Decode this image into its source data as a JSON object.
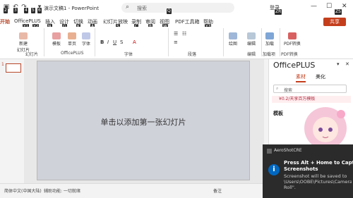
{
  "titlebar": {
    "doc_title": "演示文稿1  -  PowerPoint",
    "search_placeholder": "搜索",
    "user_name": "登录",
    "keytips": [
      "2",
      "3",
      "4",
      "5",
      "6",
      "Q",
      "ZR",
      "ZS"
    ]
  },
  "tabs": {
    "items": [
      "开始",
      "OfficePLUS",
      "插入",
      "设计",
      "切换",
      "动画",
      "幻灯片放映",
      "录制",
      "审阅",
      "视图",
      "PDF工具箱",
      "帮助"
    ],
    "keytips": [
      "Y1",
      "Y2",
      "N",
      "G",
      "K",
      "A",
      "S",
      "C",
      "R",
      "W",
      "Y3"
    ],
    "share": "共享"
  },
  "ribbon": {
    "new_slide": "新建",
    "new_slide_line2": "幻灯片",
    "template": "模板",
    "single_page": "单页",
    "font": "字体",
    "groups": {
      "slides": "幻灯片",
      "officeplus": "OfficePLUS",
      "font": "字体",
      "paragraph": "段落",
      "editing": "编辑",
      "addin": "加载项",
      "pdf": "PDF转换"
    },
    "drawing": "绘图",
    "editing": "编辑",
    "addin": "加载",
    "pdf_convert": "PDF转换"
  },
  "slide": {
    "placeholder": "单击以添加第一张幻灯片",
    "thumb_number": "1"
  },
  "officeplus_pane": {
    "title": "OfficePLUS",
    "tabs": [
      "素材",
      "美化"
    ],
    "search_placeholder": "搜索",
    "banner": "¥0.2/天享百万模板",
    "templates_label": "模板"
  },
  "status": {
    "language": "简体中文(中国大陆)",
    "accessibility": "辅助功能: 一切就绪",
    "notes": "备注"
  },
  "toast": {
    "app": "AeroShotCRE",
    "title": "Press Alt + Home to Capture",
    "title2": "Screenshots",
    "body_line1": "Screenshot will be saved to",
    "body_line2": "\\Users\\OOBE\\Pictures\\Camera",
    "body_line3": "Roll\"."
  },
  "colors": {
    "accent": "#b7472a",
    "share": "#c43e1c",
    "toast_bg": "#2b2b2b",
    "info": "#0067c0"
  }
}
